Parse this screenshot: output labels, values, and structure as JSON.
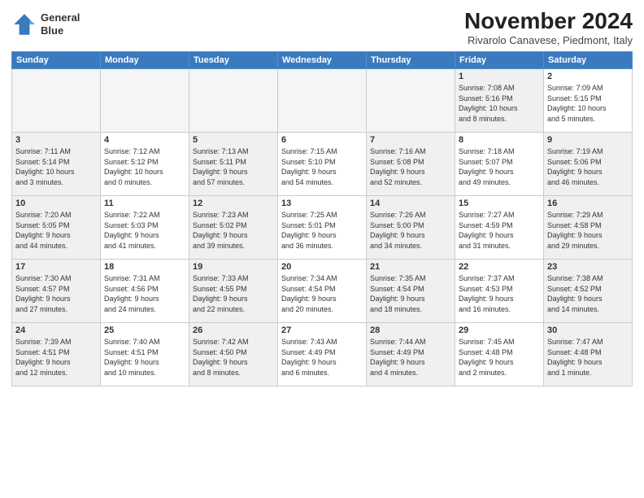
{
  "header": {
    "title": "November 2024",
    "location": "Rivarolo Canavese, Piedmont, Italy",
    "logo_line1": "General",
    "logo_line2": "Blue"
  },
  "weekdays": [
    "Sunday",
    "Monday",
    "Tuesday",
    "Wednesday",
    "Thursday",
    "Friday",
    "Saturday"
  ],
  "weeks": [
    [
      {
        "day": "",
        "info": "",
        "empty": true
      },
      {
        "day": "",
        "info": "",
        "empty": true
      },
      {
        "day": "",
        "info": "",
        "empty": true
      },
      {
        "day": "",
        "info": "",
        "empty": true
      },
      {
        "day": "",
        "info": "",
        "empty": true
      },
      {
        "day": "1",
        "info": "Sunrise: 7:08 AM\nSunset: 5:16 PM\nDaylight: 10 hours\nand 8 minutes.",
        "shaded": true
      },
      {
        "day": "2",
        "info": "Sunrise: 7:09 AM\nSunset: 5:15 PM\nDaylight: 10 hours\nand 5 minutes.",
        "shaded": false
      }
    ],
    [
      {
        "day": "3",
        "info": "Sunrise: 7:11 AM\nSunset: 5:14 PM\nDaylight: 10 hours\nand 3 minutes.",
        "shaded": true
      },
      {
        "day": "4",
        "info": "Sunrise: 7:12 AM\nSunset: 5:12 PM\nDaylight: 10 hours\nand 0 minutes.",
        "shaded": false
      },
      {
        "day": "5",
        "info": "Sunrise: 7:13 AM\nSunset: 5:11 PM\nDaylight: 9 hours\nand 57 minutes.",
        "shaded": true
      },
      {
        "day": "6",
        "info": "Sunrise: 7:15 AM\nSunset: 5:10 PM\nDaylight: 9 hours\nand 54 minutes.",
        "shaded": false
      },
      {
        "day": "7",
        "info": "Sunrise: 7:16 AM\nSunset: 5:08 PM\nDaylight: 9 hours\nand 52 minutes.",
        "shaded": true
      },
      {
        "day": "8",
        "info": "Sunrise: 7:18 AM\nSunset: 5:07 PM\nDaylight: 9 hours\nand 49 minutes.",
        "shaded": false
      },
      {
        "day": "9",
        "info": "Sunrise: 7:19 AM\nSunset: 5:06 PM\nDaylight: 9 hours\nand 46 minutes.",
        "shaded": true
      }
    ],
    [
      {
        "day": "10",
        "info": "Sunrise: 7:20 AM\nSunset: 5:05 PM\nDaylight: 9 hours\nand 44 minutes.",
        "shaded": true
      },
      {
        "day": "11",
        "info": "Sunrise: 7:22 AM\nSunset: 5:03 PM\nDaylight: 9 hours\nand 41 minutes.",
        "shaded": false
      },
      {
        "day": "12",
        "info": "Sunrise: 7:23 AM\nSunset: 5:02 PM\nDaylight: 9 hours\nand 39 minutes.",
        "shaded": true
      },
      {
        "day": "13",
        "info": "Sunrise: 7:25 AM\nSunset: 5:01 PM\nDaylight: 9 hours\nand 36 minutes.",
        "shaded": false
      },
      {
        "day": "14",
        "info": "Sunrise: 7:26 AM\nSunset: 5:00 PM\nDaylight: 9 hours\nand 34 minutes.",
        "shaded": true
      },
      {
        "day": "15",
        "info": "Sunrise: 7:27 AM\nSunset: 4:59 PM\nDaylight: 9 hours\nand 31 minutes.",
        "shaded": false
      },
      {
        "day": "16",
        "info": "Sunrise: 7:29 AM\nSunset: 4:58 PM\nDaylight: 9 hours\nand 29 minutes.",
        "shaded": true
      }
    ],
    [
      {
        "day": "17",
        "info": "Sunrise: 7:30 AM\nSunset: 4:57 PM\nDaylight: 9 hours\nand 27 minutes.",
        "shaded": true
      },
      {
        "day": "18",
        "info": "Sunrise: 7:31 AM\nSunset: 4:56 PM\nDaylight: 9 hours\nand 24 minutes.",
        "shaded": false
      },
      {
        "day": "19",
        "info": "Sunrise: 7:33 AM\nSunset: 4:55 PM\nDaylight: 9 hours\nand 22 minutes.",
        "shaded": true
      },
      {
        "day": "20",
        "info": "Sunrise: 7:34 AM\nSunset: 4:54 PM\nDaylight: 9 hours\nand 20 minutes.",
        "shaded": false
      },
      {
        "day": "21",
        "info": "Sunrise: 7:35 AM\nSunset: 4:54 PM\nDaylight: 9 hours\nand 18 minutes.",
        "shaded": true
      },
      {
        "day": "22",
        "info": "Sunrise: 7:37 AM\nSunset: 4:53 PM\nDaylight: 9 hours\nand 16 minutes.",
        "shaded": false
      },
      {
        "day": "23",
        "info": "Sunrise: 7:38 AM\nSunset: 4:52 PM\nDaylight: 9 hours\nand 14 minutes.",
        "shaded": true
      }
    ],
    [
      {
        "day": "24",
        "info": "Sunrise: 7:39 AM\nSunset: 4:51 PM\nDaylight: 9 hours\nand 12 minutes.",
        "shaded": true
      },
      {
        "day": "25",
        "info": "Sunrise: 7:40 AM\nSunset: 4:51 PM\nDaylight: 9 hours\nand 10 minutes.",
        "shaded": false
      },
      {
        "day": "26",
        "info": "Sunrise: 7:42 AM\nSunset: 4:50 PM\nDaylight: 9 hours\nand 8 minutes.",
        "shaded": true
      },
      {
        "day": "27",
        "info": "Sunrise: 7:43 AM\nSunset: 4:49 PM\nDaylight: 9 hours\nand 6 minutes.",
        "shaded": false
      },
      {
        "day": "28",
        "info": "Sunrise: 7:44 AM\nSunset: 4:49 PM\nDaylight: 9 hours\nand 4 minutes.",
        "shaded": true
      },
      {
        "day": "29",
        "info": "Sunrise: 7:45 AM\nSunset: 4:48 PM\nDaylight: 9 hours\nand 2 minutes.",
        "shaded": false
      },
      {
        "day": "30",
        "info": "Sunrise: 7:47 AM\nSunset: 4:48 PM\nDaylight: 9 hours\nand 1 minute.",
        "shaded": true
      }
    ]
  ]
}
